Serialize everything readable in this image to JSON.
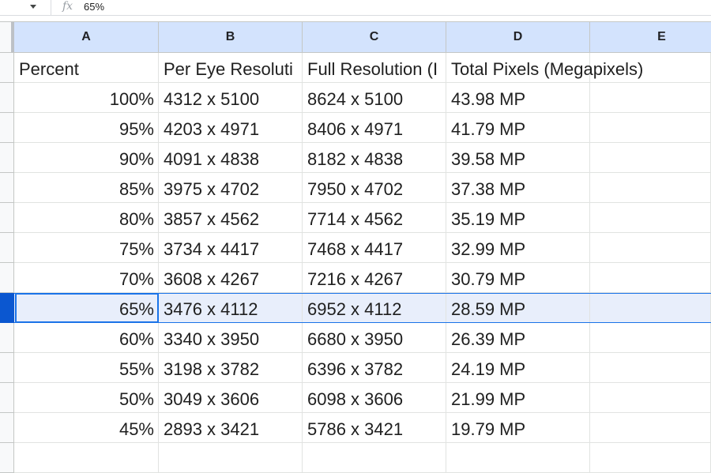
{
  "formula_bar": {
    "fx_icon": "fx",
    "content": "65%"
  },
  "columns": [
    "A",
    "B",
    "C",
    "D",
    "E"
  ],
  "header_row": [
    "Percent",
    "Per Eye Resoluti",
    "Full Resolution (I",
    "Total Pixels (Megapixels)",
    ""
  ],
  "rows": [
    [
      "100%",
      "4312 x 5100",
      "8624 x 5100",
      "43.98 MP"
    ],
    [
      "95%",
      "4203 x 4971",
      "8406 x 4971",
      "41.79 MP"
    ],
    [
      "90%",
      "4091 x 4838",
      "8182 x 4838",
      "39.58 MP"
    ],
    [
      "85%",
      "3975 x 4702",
      "7950 x 4702",
      "37.38 MP"
    ],
    [
      "80%",
      "3857 x 4562",
      "7714 x 4562",
      "35.19 MP"
    ],
    [
      "75%",
      "3734 x 4417",
      "7468 x 4417",
      "32.99 MP"
    ],
    [
      "70%",
      "3608 x 4267",
      "7216 x 4267",
      "30.79 MP"
    ],
    [
      "65%",
      "3476 x 4112",
      "6952 x 4112",
      "28.59 MP"
    ],
    [
      "60%",
      "3340 x 3950",
      "6680 x 3950",
      "26.39 MP"
    ],
    [
      "55%",
      "3198 x 3782",
      "6396 x 3782",
      "24.19 MP"
    ],
    [
      "50%",
      "3049 x 3606",
      "6098 x 3606",
      "21.99 MP"
    ],
    [
      "45%",
      "2893 x 3421",
      "5786 x 3421",
      "19.79 MP"
    ]
  ],
  "selected_cell": "A9",
  "colors": {
    "header_bg": "#d3e3fd",
    "selection_border": "#1a73e8",
    "selected_row_bg": "#e8eefb"
  }
}
